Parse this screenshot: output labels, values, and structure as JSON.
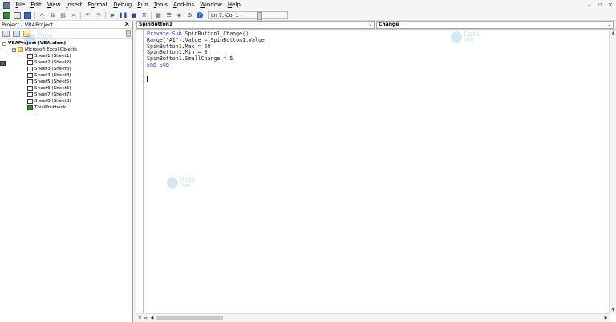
{
  "menubar": {
    "items": [
      {
        "ul": "F",
        "rest": "ile"
      },
      {
        "ul": "E",
        "rest": "dit"
      },
      {
        "ul": "V",
        "rest": "iew"
      },
      {
        "ul": "I",
        "rest": "nsert"
      },
      {
        "ul": "",
        "pre": "F",
        "mid": "o",
        "rest": "rmat"
      },
      {
        "ul": "D",
        "rest": "ebug"
      },
      {
        "ul": "R",
        "rest": "un"
      },
      {
        "ul": "T",
        "rest": "ools"
      },
      {
        "ul": "A",
        "rest": "dd-Ins"
      },
      {
        "ul": "W",
        "rest": "indow"
      },
      {
        "ul": "H",
        "rest": "elp"
      }
    ],
    "window_controls": {
      "minimize": "–",
      "restore": "▫",
      "close": "×"
    }
  },
  "toolbar": {
    "cursor_position": "Ln 7, Col 1"
  },
  "project": {
    "title": "Project - VBAProject",
    "close": "✕",
    "tree": [
      {
        "level": 0,
        "label": "VBAProject (VBA.xlsm)",
        "kind": "proj",
        "expander": "−",
        "bold": true
      },
      {
        "level": 1,
        "label": "Microsoft Excel Objects",
        "kind": "folder",
        "expander": "−"
      },
      {
        "level": 2,
        "label": "Sheet1 (Sheet1)",
        "kind": "sheet"
      },
      {
        "level": 2,
        "label": "Sheet2 (Sheet2)",
        "kind": "sheet"
      },
      {
        "level": 2,
        "label": "Sheet3 (Sheet3)",
        "kind": "sheet"
      },
      {
        "level": 2,
        "label": "Sheet4 (Sheet4)",
        "kind": "sheet"
      },
      {
        "level": 2,
        "label": "Sheet5 (Sheet5)",
        "kind": "sheet"
      },
      {
        "level": 2,
        "label": "Sheet6 (Sheet6)",
        "kind": "sheet"
      },
      {
        "level": 2,
        "label": "Sheet7 (Sheet7)",
        "kind": "sheet"
      },
      {
        "level": 2,
        "label": "Sheet8 (Sheet8)",
        "kind": "sheet"
      },
      {
        "level": 2,
        "label": "ThisWorkbook",
        "kind": "wb"
      }
    ]
  },
  "code_window": {
    "object_combo": "SpinButton1",
    "procedure_combo": "Change",
    "lines": [
      [
        {
          "t": "Private Sub ",
          "k": true
        },
        {
          "t": "SpinButton1_Change()",
          "k": false
        }
      ],
      [
        {
          "t": "Range(\"A1\").Value = SpinButton1.Value",
          "k": false
        }
      ],
      [
        {
          "t": "SpinButton1.Max = 50",
          "k": false
        }
      ],
      [
        {
          "t": "SpinButton1.Min = 0",
          "k": false
        }
      ],
      [
        {
          "t": "SpinButton1.SmallChange = 5",
          "k": false
        }
      ],
      [
        {
          "t": "End Sub",
          "k": true
        }
      ]
    ]
  },
  "watermark": {
    "line1": "Data",
    "line2": "Flair"
  },
  "colors": {
    "keyword": "#1f3a9a",
    "watermark": "#1f7fc4"
  }
}
